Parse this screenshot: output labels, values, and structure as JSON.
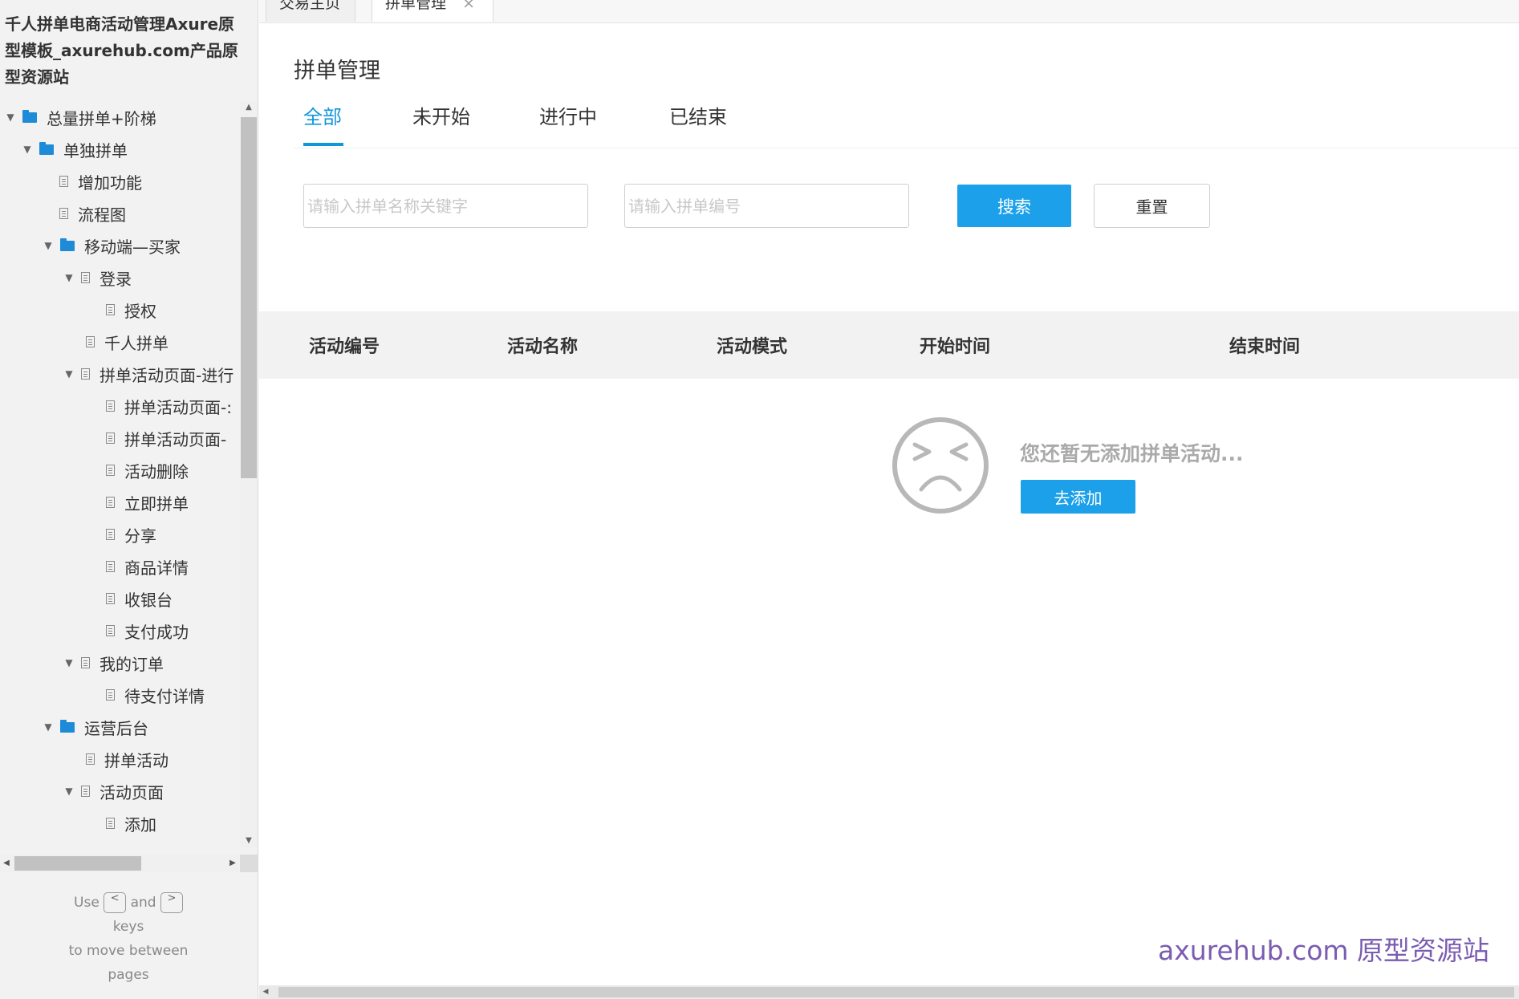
{
  "sidebar": {
    "title": "千人拼单电商活动管理Axure原型模板_axurehub.com产品原型资源站",
    "tree": [
      {
        "label": "总量拼单+阶梯",
        "type": "folder",
        "expanded": true
      },
      {
        "label": "单独拼单",
        "type": "folder",
        "expanded": true
      },
      {
        "label": "增加功能",
        "type": "page"
      },
      {
        "label": "流程图",
        "type": "page"
      },
      {
        "label": "移动端—买家",
        "type": "folder",
        "expanded": true
      },
      {
        "label": "登录",
        "type": "page",
        "expanded": true
      },
      {
        "label": "授权",
        "type": "page"
      },
      {
        "label": "千人拼单",
        "type": "page"
      },
      {
        "label": "拼单活动页面-进行",
        "type": "page",
        "expanded": true
      },
      {
        "label": "拼单活动页面-:",
        "type": "page"
      },
      {
        "label": "拼单活动页面-",
        "type": "page"
      },
      {
        "label": "活动删除",
        "type": "page"
      },
      {
        "label": "立即拼单",
        "type": "page"
      },
      {
        "label": "分享",
        "type": "page"
      },
      {
        "label": "商品详情",
        "type": "page"
      },
      {
        "label": "收银台",
        "type": "page"
      },
      {
        "label": "支付成功",
        "type": "page"
      },
      {
        "label": "我的订单",
        "type": "page",
        "expanded": true
      },
      {
        "label": "待支付详情",
        "type": "page"
      },
      {
        "label": "运营后台",
        "type": "folder",
        "expanded": true
      },
      {
        "label": "拼单活动",
        "type": "page"
      },
      {
        "label": "活动页面",
        "type": "page",
        "expanded": true
      },
      {
        "label": "添加",
        "type": "page"
      }
    ],
    "hint": {
      "use": "Use",
      "key_prev": "<",
      "and": "and",
      "key_next": ">",
      "keys": "keys",
      "line2": "to move between",
      "line3": "pages"
    }
  },
  "window_tabs": [
    {
      "label": "交易主页"
    },
    {
      "label": "拼单管理",
      "close": "×"
    }
  ],
  "main": {
    "page_title": "拼单管理",
    "filter_tabs": [
      "全部",
      "未开始",
      "进行中",
      "已结束"
    ],
    "active_tab": "全部",
    "search": {
      "name_placeholder": "请输入拼单名称关键字",
      "id_placeholder": "请输入拼单编号",
      "search_label": "搜索",
      "reset_label": "重置"
    },
    "table": {
      "columns": [
        "活动编号",
        "活动名称",
        "活动模式",
        "开始时间",
        "结束时间"
      ]
    },
    "empty_state": {
      "message": "您还暂无添加拼单活动...",
      "add_label": "去添加",
      "icon": "sad-face-icon"
    }
  },
  "watermark": "axurehub.com 原型资源站",
  "colors": {
    "accent": "#1ba0e9",
    "folder": "#1e8bd8",
    "watermark": "#7a5cb0"
  }
}
